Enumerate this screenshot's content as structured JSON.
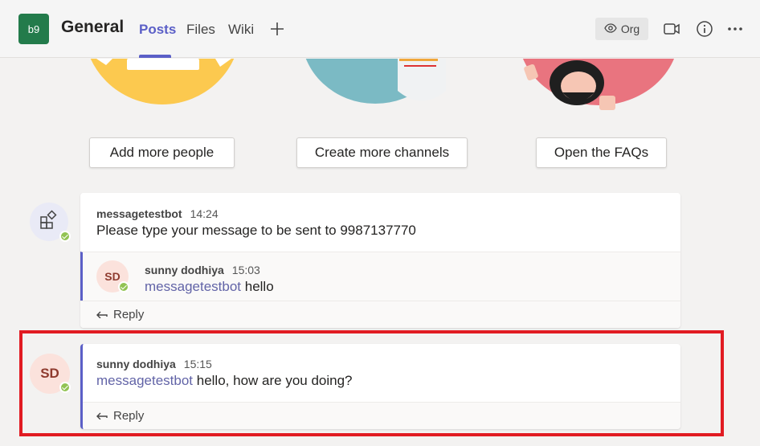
{
  "header": {
    "team_initials": "b9",
    "channel_name": "General",
    "tabs": [
      {
        "label": "Posts",
        "active": true
      },
      {
        "label": "Files",
        "active": false
      },
      {
        "label": "Wiki",
        "active": false
      }
    ],
    "org_label": "Org"
  },
  "promo_buttons": [
    "Add more people",
    "Create more channels",
    "Open the FAQs"
  ],
  "thread": {
    "root": {
      "sender": "messagetestbot",
      "time": "14:24",
      "text": "Please type your message to be sent to 9987137770"
    },
    "reply": {
      "avatar_initials": "SD",
      "sender": "sunny dodhiya",
      "time": "15:03",
      "mention": "messagetestbot",
      "text": "hello"
    },
    "reply_label": "Reply"
  },
  "post": {
    "avatar_initials": "SD",
    "sender": "sunny dodhiya",
    "time": "15:15",
    "mention": "messagetestbot",
    "text": "hello, how are you doing?",
    "reply_label": "Reply"
  },
  "colors": {
    "accent": "#5b5fc7",
    "team_avatar": "#237b4b",
    "highlight_box": "#e11b22",
    "presence": "#92c353"
  }
}
